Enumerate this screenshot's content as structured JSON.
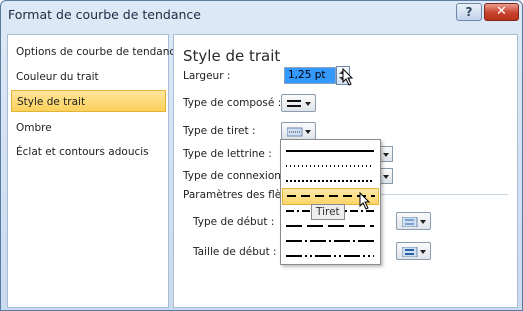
{
  "window": {
    "title": "Format de courbe de tendance",
    "help_label": "?",
    "close_label": "✕"
  },
  "nav": {
    "items": [
      {
        "label": "Options de courbe de tendance"
      },
      {
        "label": "Couleur du trait"
      },
      {
        "label": "Style de trait"
      },
      {
        "label": "Ombre"
      },
      {
        "label": "Éclat et contours adoucis"
      }
    ]
  },
  "main": {
    "title": "Style de trait",
    "width_label": "Largeur :",
    "width_value": "1,25 pt",
    "compound_label": "Type de composé :",
    "dash_label": "Type de tiret :",
    "cap_label": "Type de lettrine :",
    "join_label": "Type de connexion :",
    "arrow_section_label": "Paramètres des flèches",
    "begin_type_label": "Type de début :",
    "begin_size_label": "Taille de début :"
  },
  "dash_menu": {
    "options": [
      "Solide",
      "Point rond",
      "Point carré",
      "Tiret",
      "Tiret point",
      "Tiret long",
      "Tiret long point",
      "Tiret long point point"
    ],
    "hovered": "Tiret",
    "tooltip": "Tiret"
  },
  "colors": {
    "selection": "#fbd15a",
    "title_bar": "#c9dbef",
    "close_button": "#c8432c"
  }
}
